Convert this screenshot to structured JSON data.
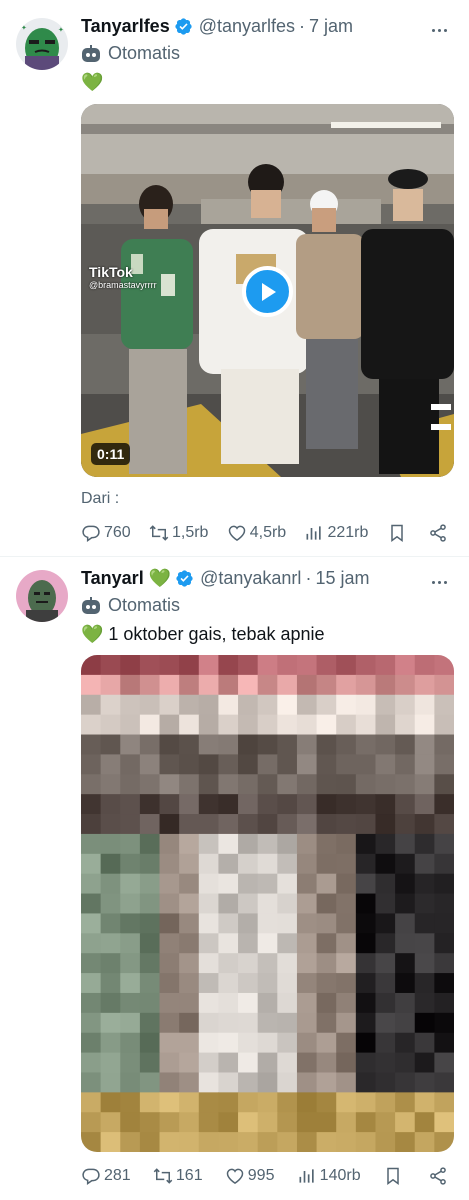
{
  "tweets": [
    {
      "display_name": "Tanyarlfes",
      "handle": "@tanyarlfes",
      "separator": "·",
      "time": "7 jam",
      "automated_label": "Otomatis",
      "text": "💚",
      "media_duration": "0:11",
      "watermark_brand": "TikTok",
      "watermark_user": "@bramastavyrrrr",
      "source_label": "Dari :",
      "stats": {
        "replies": "760",
        "retweets": "1,5rb",
        "likes": "4,5rb",
        "views": "221rb"
      }
    },
    {
      "display_name": "Tanyarl 💚",
      "handle": "@tanyakanrl",
      "separator": "·",
      "time": "15 jam",
      "automated_label": "Otomatis",
      "text": "💚 1 oktober gais, tebak apnie",
      "stats": {
        "replies": "281",
        "retweets": "161",
        "likes": "995",
        "views": "140rb"
      }
    }
  ],
  "colors": {
    "verified": "#1d9bf0",
    "muted": "#536471",
    "text": "#0f1419",
    "play": "#1d9bf0"
  },
  "icons": [
    "verified-badge-icon",
    "robot-icon",
    "reply-icon",
    "retweet-icon",
    "like-icon",
    "views-icon",
    "bookmark-icon",
    "share-icon",
    "more-icon",
    "play-icon"
  ]
}
